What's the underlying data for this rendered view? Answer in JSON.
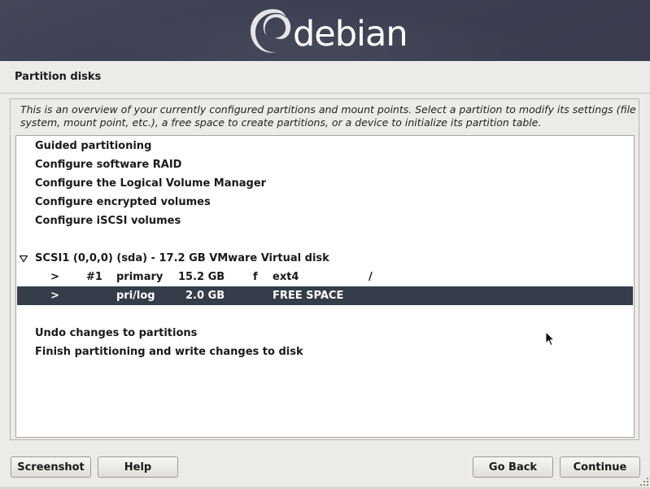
{
  "banner": {
    "logo_text": "debian"
  },
  "page": {
    "title": "Partition disks",
    "description": "This is an overview of your currently configured partitions and mount points. Select a partition to modify its settings (file system, mount point, etc.), a free space to create partitions, or a device to initialize its partition table."
  },
  "menu": {
    "guided": "Guided partitioning",
    "raid": "Configure software RAID",
    "lvm": "Configure the Logical Volume Manager",
    "encrypted": "Configure encrypted volumes",
    "iscsi": "Configure iSCSI volumes",
    "undo": "Undo changes to partitions",
    "finish": "Finish partitioning and write changes to disk"
  },
  "disk": {
    "label": "SCSI1 (0,0,0) (sda) - 17.2 GB VMware Virtual disk",
    "partitions": [
      {
        "marker": ">",
        "number": "#1",
        "type": "primary",
        "size": "15.2 GB",
        "flag": "f",
        "fs": "ext4",
        "mount": "/"
      },
      {
        "marker": ">",
        "number": "",
        "type": "pri/log",
        "size": "2.0 GB",
        "flag": "",
        "fs": "FREE SPACE",
        "mount": ""
      }
    ],
    "selected_index": 1
  },
  "buttons": {
    "screenshot": "Screenshot",
    "help": "Help",
    "go_back": "Go Back",
    "continue": "Continue"
  },
  "colors": {
    "banner": "#3c4052",
    "selection": "#353c4a",
    "window_bg": "#edebe8"
  }
}
